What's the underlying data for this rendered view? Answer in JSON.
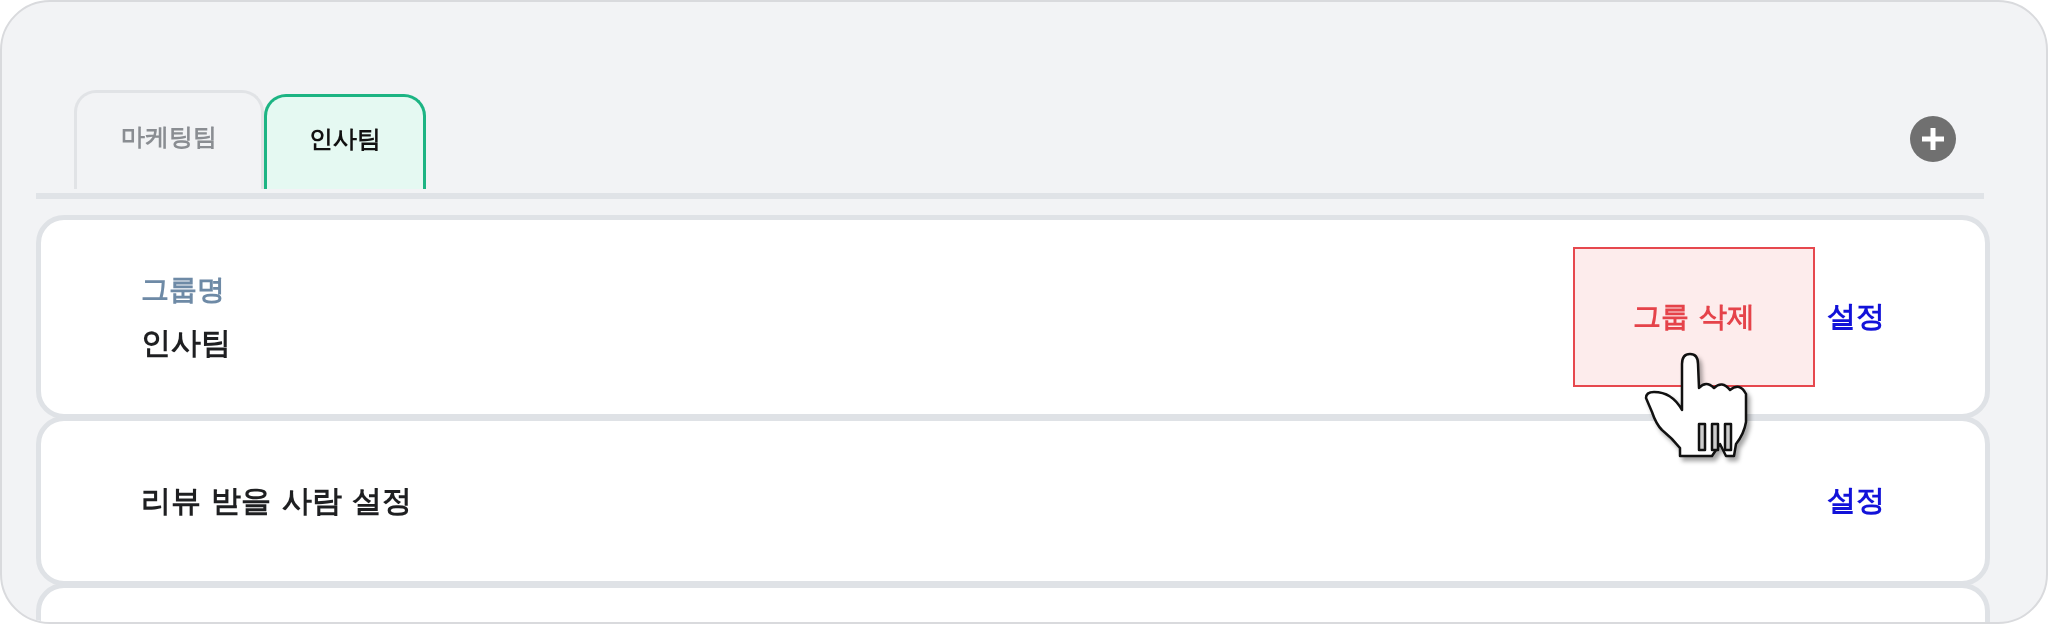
{
  "tabs": [
    {
      "label": "마케팅팀",
      "selected": false
    },
    {
      "label": "인사팀",
      "selected": true
    }
  ],
  "cards": [
    {
      "kind": "group",
      "label": "그룹명",
      "value": "인사팀",
      "delete_button": "그룹 삭제",
      "settings_link": "설정"
    },
    {
      "kind": "setting",
      "title": "리뷰 받을 사람 설정",
      "settings_link": "설정"
    },
    {
      "kind": "empty"
    }
  ]
}
